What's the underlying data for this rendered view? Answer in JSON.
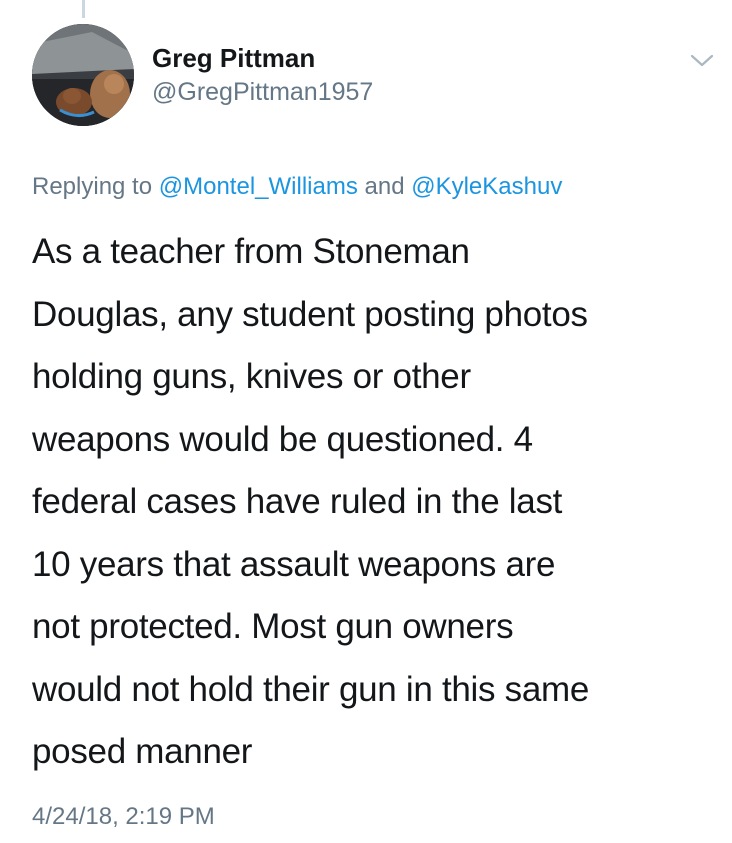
{
  "tweet": {
    "author": {
      "display_name": "Greg Pittman",
      "handle": "@GregPittman1957"
    },
    "reply_context": {
      "prefix": "Replying to",
      "mentions": [
        "@Montel_Williams",
        "@KyleKashuv"
      ],
      "joiner": "and"
    },
    "text": "As a teacher from Stoneman\nDouglas, any student posting photos\nholding guns, knives or other\nweapons would be questioned. 4\nfederal cases have ruled in the last\n10 years that assault weapons are\nnot protected. Most  gun owners\nwould not hold their gun in this same\nposed manner",
    "timestamp": "4/24/18, 2:19 PM"
  },
  "icons": {
    "menu": "chevron-down-icon",
    "avatar": "avatar"
  },
  "colors": {
    "link": "#1b95e0",
    "secondary_text": "#657786",
    "primary_text": "#14171a",
    "thread_line": "#ccd6dd"
  }
}
